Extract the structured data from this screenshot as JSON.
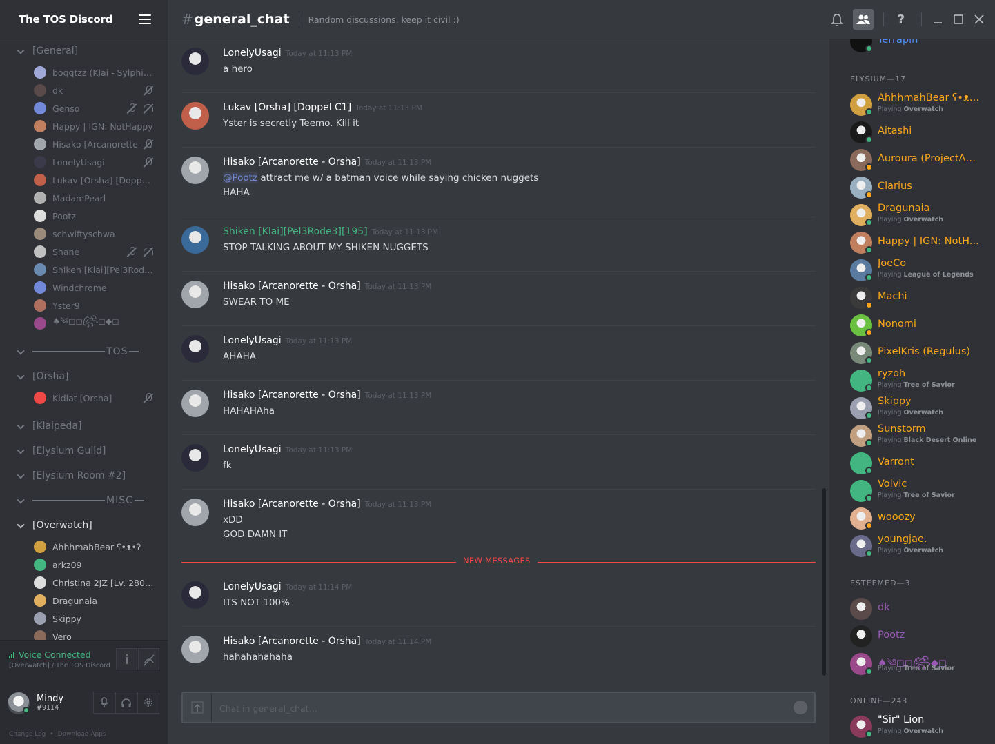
{
  "server": {
    "name": "The TOS Discord"
  },
  "sidebar": {
    "categories": [
      {
        "label": "[General]",
        "open": false
      },
      {
        "label": "TOS"
      },
      {
        "label": "[Orsha]"
      },
      {
        "label": "[Klaipeda]"
      },
      {
        "label": "[Elysium Guild]"
      },
      {
        "label": "[Elysium Room #2]"
      },
      {
        "label": "MISC"
      },
      {
        "label": "[Overwatch]"
      }
    ],
    "general_voice_users": [
      {
        "name": "boqqtzz (Klai - Sylphinfor...",
        "muted": false,
        "deaf": false,
        "color": "#a0a8d8"
      },
      {
        "name": "dk",
        "muted": true,
        "deaf": false,
        "color": "#5a4a4a"
      },
      {
        "name": "Genso",
        "muted": true,
        "deaf": true,
        "color": "#7289da"
      },
      {
        "name": "Happy | IGN: NotHappy",
        "muted": false,
        "deaf": false,
        "color": "#c08060"
      },
      {
        "name": "Hisako [Arcanorette - ...",
        "muted": true,
        "deaf": false,
        "color": "#a0a6ac"
      },
      {
        "name": "LonelyUsagi",
        "muted": true,
        "deaf": false,
        "color": "#3a3a4a"
      },
      {
        "name": "Lukav [Orsha] [Doppel C1]",
        "muted": false,
        "deaf": false,
        "color": "#c0604a"
      },
      {
        "name": "MadamPearl",
        "muted": false,
        "deaf": false,
        "color": "#b0b0b0"
      },
      {
        "name": "Pootz",
        "muted": false,
        "deaf": false,
        "color": "#ddd"
      },
      {
        "name": "schwiftyschwa",
        "muted": false,
        "deaf": false,
        "color": "#9a8a7a"
      },
      {
        "name": "Shane",
        "muted": true,
        "deaf": true,
        "color": "#c0c0c0"
      },
      {
        "name": "Shiken [Klai][Pel3Rode3]...",
        "muted": false,
        "deaf": false,
        "color": "#6a8ab0"
      },
      {
        "name": "Windchrome",
        "muted": false,
        "deaf": false,
        "color": "#7289da"
      },
      {
        "name": "Yster9",
        "muted": false,
        "deaf": false,
        "color": "#b07060"
      },
      {
        "name": "♠༄◻◻꧂ꦿꦼ◻◆◻",
        "muted": false,
        "deaf": false,
        "color": "#9a4a8a"
      }
    ],
    "orsha_voice_users": [
      {
        "name": "Kidlat [Orsha]",
        "muted": true,
        "color": "#f04747"
      }
    ],
    "overwatch_voice_users": [
      {
        "name": "AhhhmahBear ʕ•ᴥ•ʔ",
        "color": "#d0a040"
      },
      {
        "name": "arkz09",
        "color": "#43b581"
      },
      {
        "name": "Christina 2JZ [Lv. 280 Fle...",
        "color": "#ddd"
      },
      {
        "name": "Dragunaia",
        "color": "#e0b060"
      },
      {
        "name": "Skippy",
        "color": "#9aa0b0"
      },
      {
        "name": "Vero",
        "color": "#8a6a5a"
      }
    ]
  },
  "voice_panel": {
    "status": "Voice Connected",
    "location": "[Overwatch] / The TOS Discord"
  },
  "user_panel": {
    "name": "Mindy",
    "tag": "#9114",
    "links": [
      "Change Log",
      "•",
      "Download Apps"
    ]
  },
  "header": {
    "hash": "#",
    "channel": "general_chat",
    "topic": "Random discussions, keep it civil :)"
  },
  "messages": [
    {
      "author": "LonelyUsagi",
      "color": "#ffffff",
      "ts": "Today at 11:13 PM",
      "lines": [
        "a hero"
      ],
      "avatar": "#2a2a3a"
    },
    {
      "author": "Lukav [Orsha] [Doppel C1]",
      "color": "#ffffff",
      "ts": "Today at 11:13 PM",
      "lines": [
        "Yster is secretly Teemo. Kill it"
      ],
      "avatar": "#c0604a"
    },
    {
      "author": "Hisako [Arcanorette - Orsha]",
      "color": "#ffffff",
      "ts": "Today at 11:13 PM",
      "mention": "@Pootz",
      "lines": [
        " attract me w/ a batman voice while saying chicken nuggets",
        "HAHA"
      ],
      "avatar": "#a0a6ac"
    },
    {
      "author": "Shiken [Klai][Pel3Rode3][195]",
      "color": "#43b581",
      "ts": "Today at 11:13 PM",
      "lines": [
        "STOP TALKING ABOUT MY SHIKEN NUGGETS"
      ],
      "avatar": "#3a6a9a"
    },
    {
      "author": "Hisako [Arcanorette - Orsha]",
      "color": "#ffffff",
      "ts": "Today at 11:13 PM",
      "lines": [
        "SWEAR TO ME"
      ],
      "avatar": "#a0a6ac"
    },
    {
      "author": "LonelyUsagi",
      "color": "#ffffff",
      "ts": "Today at 11:13 PM",
      "lines": [
        "AHAHA"
      ],
      "avatar": "#2a2a3a"
    },
    {
      "author": "Hisako [Arcanorette - Orsha]",
      "color": "#ffffff",
      "ts": "Today at 11:13 PM",
      "lines": [
        "HAHAHAha"
      ],
      "avatar": "#a0a6ac"
    },
    {
      "author": "LonelyUsagi",
      "color": "#ffffff",
      "ts": "Today at 11:13 PM",
      "lines": [
        "fk"
      ],
      "avatar": "#2a2a3a"
    },
    {
      "author": "Hisako [Arcanorette - Orsha]",
      "color": "#ffffff",
      "ts": "Today at 11:13 PM",
      "lines": [
        "xDD",
        "GOD DAMN IT"
      ],
      "avatar": "#a0a6ac"
    },
    {
      "author": "LonelyUsagi",
      "color": "#ffffff",
      "ts": "Today at 11:14 PM",
      "lines": [
        "ITS NOT 100%"
      ],
      "avatar": "#2a2a3a"
    },
    {
      "author": "Hisako [Arcanorette - Orsha]",
      "color": "#ffffff",
      "ts": "Today at 11:14 PM",
      "lines": [
        "hahahahahaha"
      ],
      "avatar": "#a0a6ac"
    }
  ],
  "new_messages_label": "NEW MESSAGES",
  "chat_input": {
    "placeholder": "Chat in general_chat..."
  },
  "members": {
    "top_partial": {
      "name": "Terrapin",
      "color": "#4f8ef7"
    },
    "groups": [
      {
        "title": "ELYSIUM—17",
        "users": [
          {
            "name": "AhhhmahBear ʕ•ᴥ•...",
            "game": "Overwatch",
            "color": "#faa61a",
            "status": "#43b581",
            "av": "#d0a040"
          },
          {
            "name": "Aitashi",
            "game": "",
            "color": "#faa61a",
            "status": "#43b581",
            "av": "#1a1a1a"
          },
          {
            "name": "Auroura (ProjectAu...",
            "game": "",
            "color": "#faa61a",
            "status": "#faa61a",
            "av": "#8a6a5a"
          },
          {
            "name": "Clarius",
            "game": "",
            "color": "#faa61a",
            "status": "#faa61a",
            "av": "#9ab0c0"
          },
          {
            "name": "Dragunaia",
            "game": "Overwatch",
            "color": "#faa61a",
            "status": "#43b581",
            "av": "#e0b060"
          },
          {
            "name": "Happy | IGN: NotH...",
            "game": "",
            "color": "#faa61a",
            "status": "#43b581",
            "av": "#c08060"
          },
          {
            "name": "JoeCo",
            "game": "League of Legends",
            "color": "#faa61a",
            "status": "#43b581",
            "av": "#5a7aa0"
          },
          {
            "name": "Machi",
            "game": "",
            "color": "#faa61a",
            "status": "#faa61a",
            "av": "#3a3a3a"
          },
          {
            "name": "Nonomi",
            "game": "",
            "color": "#faa61a",
            "status": "#faa61a",
            "av": "#6ac040"
          },
          {
            "name": "PixelKris (Regulus)",
            "game": "",
            "color": "#faa61a",
            "status": "#43b581",
            "av": "#7a8a7a"
          },
          {
            "name": "ryzoh",
            "game": "Tree of Savior",
            "color": "#faa61a",
            "status": "#43b581",
            "av": "#43b581"
          },
          {
            "name": "Skippy",
            "game": "Overwatch",
            "color": "#faa61a",
            "status": "#43b581",
            "av": "#9aa0b0"
          },
          {
            "name": "Sunstorm",
            "game": "Black Desert Online",
            "color": "#faa61a",
            "status": "#43b581",
            "av": "#c0a080"
          },
          {
            "name": "Varront",
            "game": "",
            "color": "#faa61a",
            "status": "#43b581",
            "av": "#43b581"
          },
          {
            "name": "Volvic",
            "game": "Tree of Savior",
            "color": "#faa61a",
            "status": "#43b581",
            "av": "#43b581"
          },
          {
            "name": "wooozy",
            "game": "",
            "color": "#faa61a",
            "status": "#faa61a",
            "av": "#e0b090"
          },
          {
            "name": "youngjae.",
            "game": "Overwatch",
            "color": "#faa61a",
            "status": "#43b581",
            "av": "#6a6a8a"
          }
        ]
      },
      {
        "title": "ESTEEMED—3",
        "users": [
          {
            "name": "dk",
            "game": "",
            "color": "#9b59b6",
            "status": "",
            "av": "#5a4a4a"
          },
          {
            "name": "Pootz",
            "game": "",
            "color": "#9b59b6",
            "status": "",
            "av": "#222"
          },
          {
            "name": "♠༄◻◻꧂ꦿꦼ◆◻",
            "game": "Tree of Savior",
            "color": "#9b59b6",
            "status": "#43b581",
            "av": "#9a4a8a"
          }
        ]
      },
      {
        "title": "ONLINE—243",
        "users": [
          {
            "name": "\"Sir\" Lion",
            "game": "Overwatch",
            "color": "#ffffff",
            "status": "#43b581",
            "av": "#8a3a5a"
          }
        ]
      }
    ],
    "playing_label": "Playing"
  },
  "icons": {
    "hamburger": "menu-icon",
    "bell": "bell-icon",
    "members": "members-icon",
    "help": "help-icon",
    "minimize": "minimize-icon",
    "maximize": "maximize-icon",
    "close": "close-icon"
  }
}
